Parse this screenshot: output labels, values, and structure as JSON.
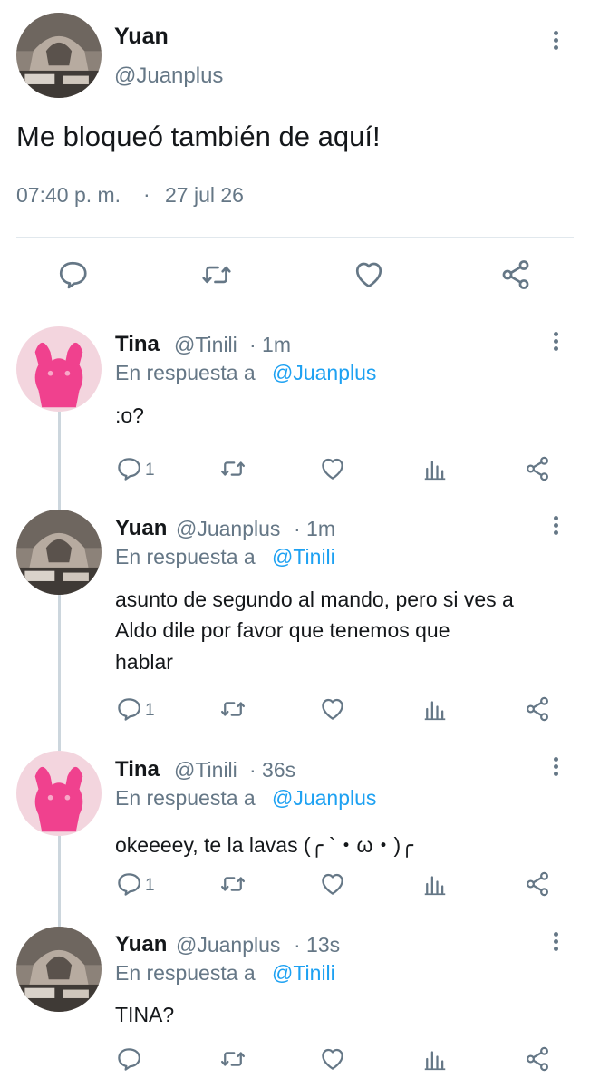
{
  "main_tweet": {
    "name": "Yuan",
    "handle": "@Juanplus",
    "text": "Me bloqueó también de aquí!",
    "time": "07:40 p. m.",
    "separator": "·",
    "date": "27 jul 26",
    "actions": [
      "reply-icon",
      "retweet-icon",
      "like-icon",
      "share-icon"
    ]
  },
  "replies": [
    {
      "name": "Tina",
      "handle": "@Tinili",
      "age": "· 1m",
      "reply_prefix": "En respuesta a",
      "reply_to": "@Juanplus",
      "text": ":o?",
      "reply_count": "1",
      "avatar": "tina"
    },
    {
      "name": "Yuan",
      "handle": "@Juanplus",
      "age": "· 1m",
      "reply_prefix": "En respuesta a",
      "reply_to": "@Tinili",
      "text_lines": [
        "asunto de segundo al mando, pero si ves a",
        "Aldo dile por favor que tenemos que",
        "hablar"
      ],
      "reply_count": "1",
      "avatar": "yuan"
    },
    {
      "name": "Tina",
      "handle": "@Tinili",
      "age": "· 36s",
      "reply_prefix": "En respuesta a",
      "reply_to": "@Juanplus",
      "text": "okeeeey, te la lavas (╭ `・ω・)╭",
      "reply_count": "1",
      "avatar": "tina"
    },
    {
      "name": "Yuan",
      "handle": "@Juanplus",
      "age": "· 13s",
      "reply_prefix": "En respuesta a",
      "reply_to": "@Tinili",
      "text": "TINA?",
      "reply_count": "",
      "avatar": "yuan"
    }
  ],
  "colors": {
    "link": "#1da1f2",
    "muted": "#657786",
    "tina_avatar_bg": "#f3d5de",
    "tina_avatar_figure": "#f0418e"
  }
}
